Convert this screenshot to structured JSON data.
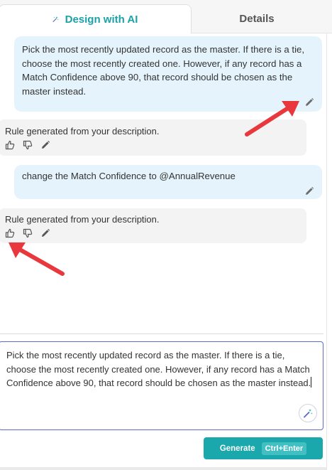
{
  "tabs": {
    "design_ai": "Design with AI",
    "details": "Details"
  },
  "messages": [
    {
      "role": "user",
      "text": "Pick the most recently updated record as the master. If there is a tie, choose the most recently created one. However, if any record has a Match Confidence above 90, that record should be chosen as the master instead."
    },
    {
      "role": "assistant",
      "text": "Rule generated from your description."
    },
    {
      "role": "user",
      "text": "change the Match Confidence to @AnnualRevenue"
    },
    {
      "role": "assistant",
      "text": "Rule generated from your description."
    }
  ],
  "icons": {
    "tab": "magic-wand-icon",
    "edit": "pencil-icon",
    "like": "thumbs-up-icon",
    "dislike": "thumbs-down-icon",
    "improve": "magic-wand-icon"
  },
  "composer": {
    "text": "Pick the most recently updated record as the master. If there is a tie, choose the most recently created one. However, if any record has a Match Confidence above 90, that record should be chosen as the master instead."
  },
  "generate": {
    "label": "Generate",
    "shortcut": "Ctrl+Enter"
  },
  "colors": {
    "accent": "#1ba1a6",
    "user_bubble": "#e5f4fc",
    "assistant_bubble": "#f3f3f3",
    "annotation_arrow": "#e8383d",
    "composer_border": "#5b6cc9"
  }
}
